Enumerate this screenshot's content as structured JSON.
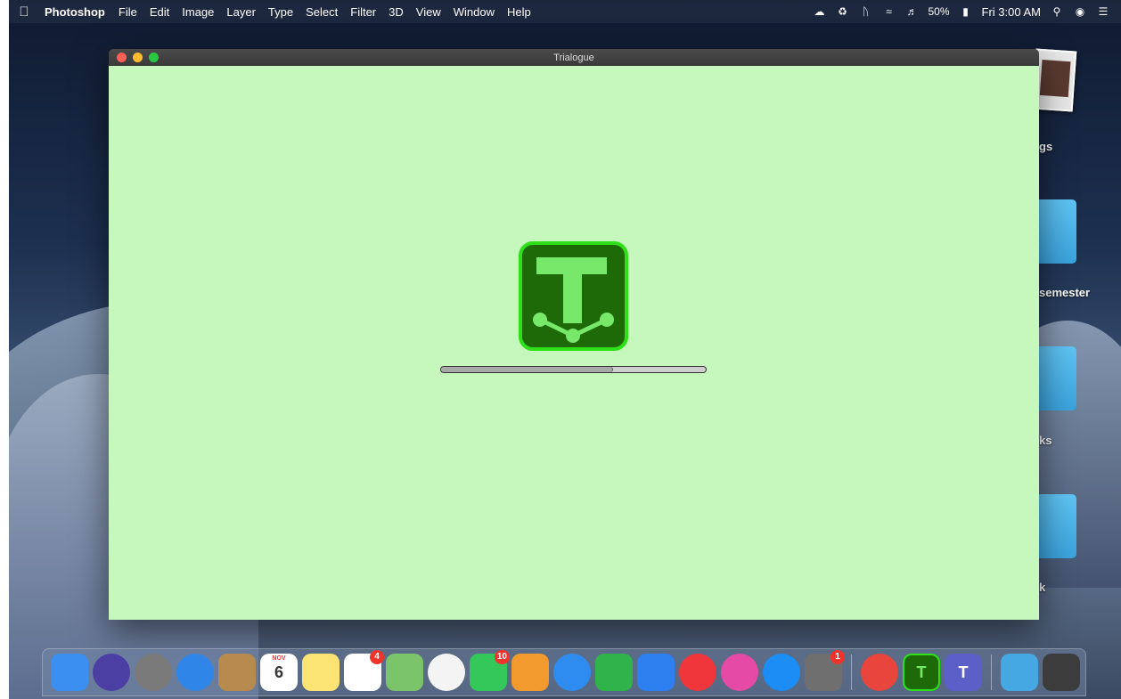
{
  "menubar": {
    "apple_icon": "apple-icon",
    "app_name": "Photoshop",
    "menus": [
      "File",
      "Edit",
      "Image",
      "Layer",
      "Type",
      "Select",
      "Filter",
      "3D",
      "View",
      "Window",
      "Help"
    ],
    "battery": "50%",
    "clock": "Fri 3:00 AM"
  },
  "desktop": {
    "labels": [
      "gs",
      "semester",
      "ks",
      "k"
    ]
  },
  "window": {
    "title": "Trialogue",
    "background_color": "#c6f7bc",
    "logo_letter": "T",
    "progress_fraction": 0.65
  },
  "dock": {
    "items": [
      {
        "name": "finder-icon",
        "color": "#3a8ff0"
      },
      {
        "name": "siri-icon",
        "color": "#4b3fa3"
      },
      {
        "name": "launchpad-icon",
        "color": "#7a7a7a"
      },
      {
        "name": "safari-icon",
        "color": "#2f86e8"
      },
      {
        "name": "contacts-icon",
        "color": "#b78a4e"
      },
      {
        "name": "calendar-icon",
        "color": "#ffffff",
        "text": "6",
        "subtext": "NOV"
      },
      {
        "name": "notes-icon",
        "color": "#fbe474"
      },
      {
        "name": "reminders-icon",
        "color": "#ffffff",
        "badge": "4"
      },
      {
        "name": "maps-icon",
        "color": "#7cc46a"
      },
      {
        "name": "photos-icon",
        "color": "#f4f4f4"
      },
      {
        "name": "facetime-icon",
        "color": "#34c759",
        "badge": "10"
      },
      {
        "name": "pages-icon",
        "color": "#f29a2e"
      },
      {
        "name": "messages-icon",
        "color": "#2e8cf0"
      },
      {
        "name": "numbers-icon",
        "color": "#2fb34a"
      },
      {
        "name": "keynote-icon",
        "color": "#2e7ff0"
      },
      {
        "name": "news-icon",
        "color": "#f0353b"
      },
      {
        "name": "itunes-icon",
        "color": "#e44aa6"
      },
      {
        "name": "app-store-icon",
        "color": "#1c8df4"
      },
      {
        "name": "system-preferences-icon",
        "color": "#6f6f6f",
        "badge": "1"
      },
      {
        "name": "chrome-icon",
        "color": "#e8453c"
      },
      {
        "name": "trialogue-icon",
        "color": "#1e6a08",
        "text": "T"
      },
      {
        "name": "teams-icon",
        "color": "#5b5fc7",
        "text": "T"
      },
      {
        "name": "downloads-folder-icon",
        "color": "#45a8e3"
      },
      {
        "name": "trash-icon",
        "color": "#3c3c3c"
      }
    ]
  }
}
